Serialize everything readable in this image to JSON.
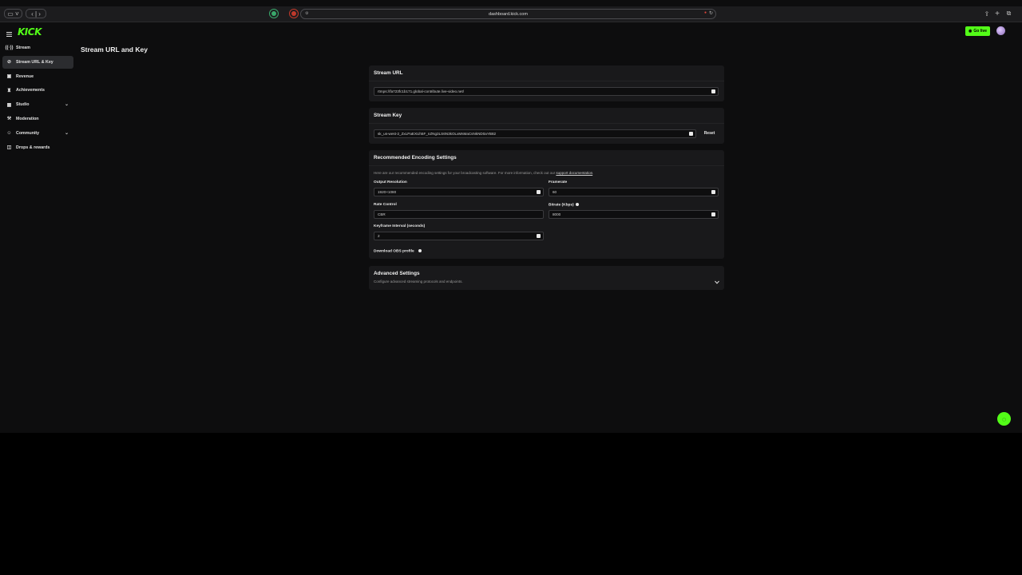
{
  "browser": {
    "url": "dashboard.kick.com"
  },
  "header": {
    "logo": "KICK",
    "go_live_label": "Go live"
  },
  "sidebar": {
    "items": [
      {
        "label": "Stream",
        "icon": "broadcast-icon"
      },
      {
        "label": "Stream URL & Key",
        "icon": "link-icon"
      },
      {
        "label": "Revenue",
        "icon": "wallet-icon"
      },
      {
        "label": "Achievements",
        "icon": "trophy-icon"
      },
      {
        "label": "Studio",
        "icon": "grid-icon"
      },
      {
        "label": "Moderation",
        "icon": "gavel-icon"
      },
      {
        "label": "Community",
        "icon": "people-icon"
      },
      {
        "label": "Drops & rewards",
        "icon": "gift-icon"
      }
    ]
  },
  "page": {
    "title": "Stream URL and Key"
  },
  "stream_url": {
    "title": "Stream URL",
    "value": "rtmps://fa723fc1b171.global-contribute.live-video.net/"
  },
  "stream_key": {
    "title": "Stream Key",
    "value": "sk_us-west-2_ZxLPaEXUh5F_nZNg3LS6N3kOLxMsMaCsNkND0aYB82",
    "reset_label": "Reset"
  },
  "encoding": {
    "title": "Recommended Encoding Settings",
    "description": "Here are our recommended encoding settings for your broadcasting software. For more information, check out our",
    "link_text": "support documentation",
    "output_resolution_label": "Output Resolution",
    "output_resolution_value": "1920×1080",
    "framerate_label": "Framerate",
    "framerate_value": "60",
    "rate_control_label": "Rate Control",
    "rate_control_value": "CBR",
    "bitrate_label": "Bitrate (Kbps)",
    "bitrate_value": "8000",
    "keyframe_label": "Keyframe Interval (seconds)",
    "keyframe_value": "2",
    "download_label": "Download OBS profile"
  },
  "advanced": {
    "title": "Advanced Settings",
    "subtitle": "Configure advanced streaming protocols and endpoints."
  },
  "colors": {
    "brand": "#53fc18",
    "background": "#0d0d0e",
    "panel": "#19191b"
  }
}
